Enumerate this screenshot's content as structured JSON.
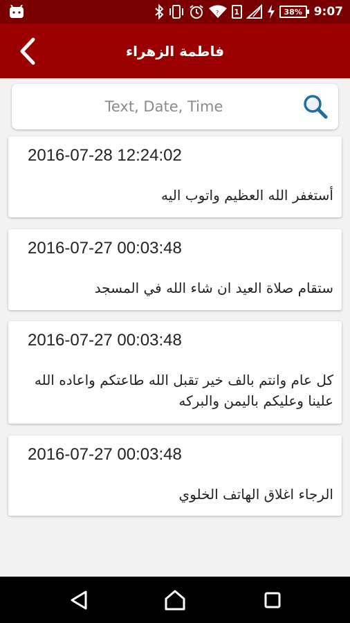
{
  "status_bar": {
    "time": "9:07",
    "battery": "38%",
    "sim": "1",
    "icons": [
      "android-icon",
      "bluetooth-icon",
      "vibrate-icon",
      "alarm-icon",
      "wifi-icon",
      "sim-icon",
      "signal-icon",
      "charging-icon",
      "battery-icon"
    ]
  },
  "app_bar": {
    "title": "فاطمة الزهراء",
    "back_icon": "chevron-left-icon",
    "color": "#9b0000"
  },
  "search": {
    "placeholder": "Text, Date, Time",
    "icon": "search-icon",
    "icon_color": "#1f6f9e"
  },
  "messages": [
    {
      "date": "2016-07-28 12:24:02",
      "text": "أستغفر الله العظيم واتوب اليه"
    },
    {
      "date": "2016-07-27 00:03:48",
      "text": "ستقام صلاة العيد ان شاء الله في المسجد"
    },
    {
      "date": "2016-07-27 00:03:48",
      "text": "كل عام وانتم بالف خير تقبل الله طاعتكم واعاده الله علينا وعليكم باليمن والبركه"
    },
    {
      "date": "2016-07-27 00:03:48",
      "text": "الرجاء اغلاق الهاتف الخلوي"
    }
  ],
  "nav_bar": {
    "icons": [
      "back-triangle-icon",
      "home-icon",
      "recents-icon"
    ]
  }
}
